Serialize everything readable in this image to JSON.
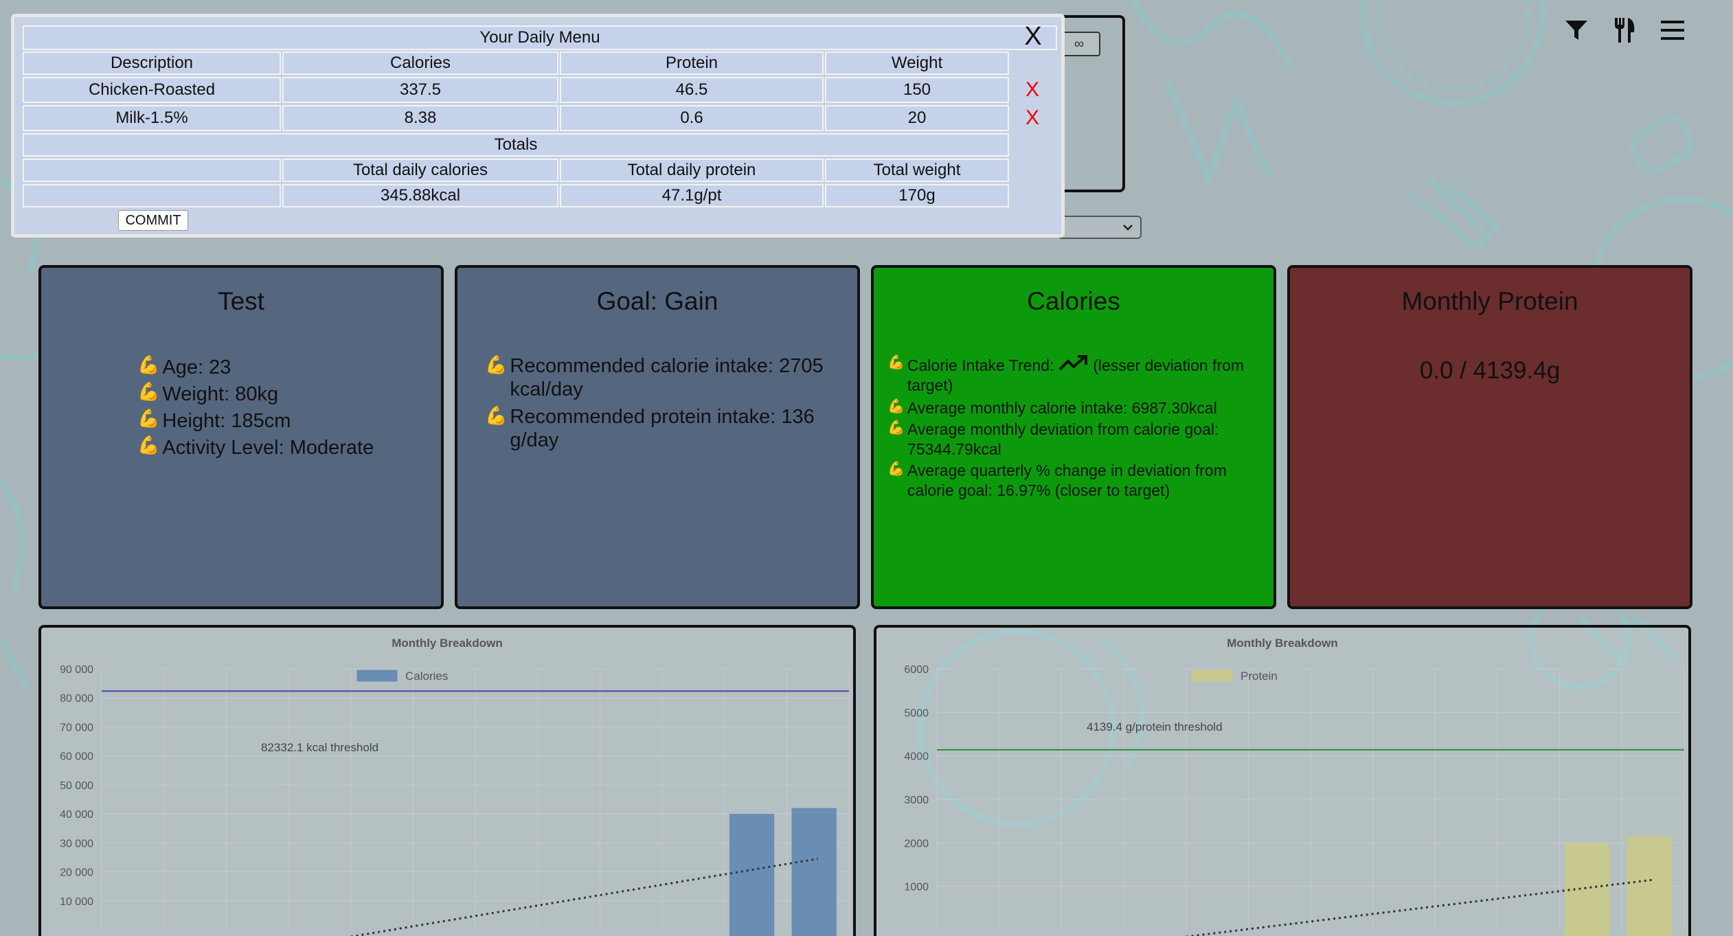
{
  "modal": {
    "title": "Your Daily Menu",
    "close_label": "X",
    "headers": [
      "Description",
      "Calories",
      "Protein",
      "Weight"
    ],
    "items": [
      {
        "description": "Chicken-Roasted",
        "calories": "337.5",
        "protein": "46.5",
        "weight": "150",
        "delete_label": "X"
      },
      {
        "description": "Milk-1.5%",
        "calories": "8.38",
        "protein": "0.6",
        "weight": "20",
        "delete_label": "X"
      }
    ],
    "totals_label": "Totals",
    "totals_headers": [
      "Total daily calories",
      "Total daily protein",
      "Total weight"
    ],
    "totals_values": [
      "345.88kcal",
      "47.1g/pt",
      "170g"
    ],
    "commit_label": "COMMIT"
  },
  "ghost": {
    "button_label": "∞"
  },
  "nav": {
    "icons": [
      "filter-icon",
      "fork-knife-icon",
      "hamburger-menu-icon"
    ]
  },
  "cards": {
    "profile": {
      "title": "Test",
      "items": [
        "Age: 23",
        "Weight: 80kg",
        "Height: 185cm",
        "Activity Level: Moderate"
      ]
    },
    "goal": {
      "title": "Goal: Gain",
      "items": [
        "Recommended calorie intake: 2705 kcal/day",
        "Recommended protein intake: 136 g/day"
      ]
    },
    "calories": {
      "title": "Calories",
      "trend_prefix": "Calorie Intake Trend:",
      "trend_suffix": "(lesser deviation from target)",
      "items": [
        "Average monthly calorie intake: 6987.30kcal",
        "Average monthly deviation from calorie goal: 75344.79kcal",
        "Average quarterly % change in deviation from calorie goal: 16.97% (closer to target)"
      ]
    },
    "protein": {
      "title": "Monthly Protein",
      "value": "0.0 / 4139.4g"
    }
  },
  "colors": {
    "card_blue": "#55677f",
    "card_green": "#0c9a0c",
    "card_red": "#6b2d2e",
    "delete_red": "#e00000",
    "calories_bar": "#6a8db3",
    "protein_bar": "#c8c98e"
  },
  "chart_data": [
    {
      "type": "bar",
      "title": "Monthly Breakdown",
      "series": [
        {
          "name": "Calories",
          "values": [
            0,
            0,
            0,
            0,
            0,
            0,
            0,
            0,
            0,
            0,
            40000,
            42000
          ]
        }
      ],
      "threshold": {
        "value": 82332.1,
        "label": "82332.1 kcal threshold"
      },
      "trendline": {
        "from": 0,
        "to": 24500
      },
      "ylim": [
        0,
        90000
      ],
      "yticks": [
        "10 000",
        "20 000",
        "30 000",
        "40 000",
        "50 000",
        "60 000",
        "70 000",
        "80 000",
        "90 000"
      ],
      "ytick_values": [
        10000,
        20000,
        30000,
        40000,
        50000,
        60000,
        70000,
        80000,
        90000
      ],
      "grid": true,
      "legend": "top-center"
    },
    {
      "type": "bar",
      "title": "Monthly Breakdown",
      "series": [
        {
          "name": "Protein",
          "values": [
            0,
            0,
            0,
            0,
            0,
            0,
            0,
            0,
            0,
            0,
            2000,
            2150
          ]
        }
      ],
      "threshold": {
        "value": 4139.4,
        "label": "4139.4 g/protein threshold"
      },
      "trendline": {
        "from": 0,
        "to": 1150
      },
      "ylim": [
        0,
        6000
      ],
      "yticks": [
        "1000",
        "2000",
        "3000",
        "4000",
        "5000",
        "6000"
      ],
      "ytick_values": [
        1000,
        2000,
        3000,
        4000,
        5000,
        6000
      ],
      "grid": true,
      "legend": "top-center"
    }
  ]
}
